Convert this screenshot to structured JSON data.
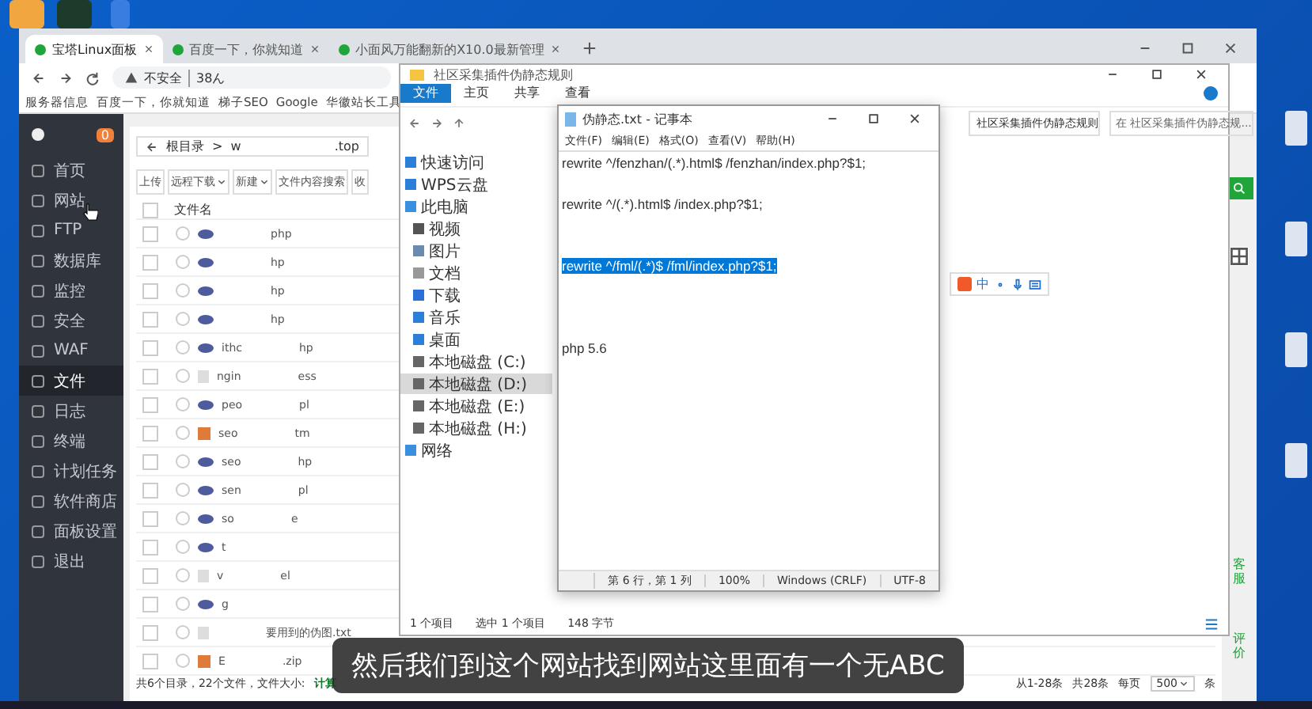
{
  "browser": {
    "tabs": [
      {
        "label": "宝塔Linux面板",
        "selected": true
      },
      {
        "label": "百度一下，你就知道",
        "selected": false
      },
      {
        "label": "小面风万能翻新的X10.0最新管理",
        "selected": false
      }
    ],
    "address": {
      "security": "不安全",
      "url": "38ん"
    },
    "bookmarks": [
      "服务器信息",
      "百度一下，你就知道",
      "梯子SEO",
      "Google",
      "华徽站长工具"
    ]
  },
  "panel": {
    "badge": "0",
    "sidebar": [
      {
        "label": "首页",
        "selected": false
      },
      {
        "label": "网站",
        "selected": false
      },
      {
        "label": "FTP",
        "selected": false
      },
      {
        "label": "数据库",
        "selected": false
      },
      {
        "label": "监控",
        "selected": false
      },
      {
        "label": "安全",
        "selected": false
      },
      {
        "label": "WAF",
        "selected": false
      },
      {
        "label": "文件",
        "selected": true
      },
      {
        "label": "日志",
        "selected": false
      },
      {
        "label": "终端",
        "selected": false
      },
      {
        "label": "计划任务",
        "selected": false
      },
      {
        "label": "软件商店",
        "selected": false
      },
      {
        "label": "面板设置",
        "selected": false
      },
      {
        "label": "退出",
        "selected": false
      }
    ],
    "breadcrumb": {
      "root": "根目录",
      "sep": ">",
      "folder": "w",
      "end": ".top"
    },
    "toolbar": [
      {
        "label": "上传",
        "kind": "plain"
      },
      {
        "label": "远程下载",
        "kind": "dropdown"
      },
      {
        "label": "新建",
        "kind": "dropdown"
      },
      {
        "label": "文件内容搜索",
        "kind": "plain"
      },
      {
        "label": "收",
        "kind": "plain"
      }
    ],
    "column": "文件名",
    "all_checked": false,
    "rows": [
      {
        "kind": "php",
        "right": "php",
        "checked": false
      },
      {
        "kind": "php",
        "right": "hp",
        "checked": false
      },
      {
        "kind": "php",
        "right": "hp",
        "checked": false
      },
      {
        "kind": "php",
        "right": "hp",
        "checked": false
      },
      {
        "kind": "php",
        "left": "ithc",
        "right": "hp",
        "checked": false
      },
      {
        "kind": "text",
        "left": "ngin",
        "right": "ess",
        "checked": false
      },
      {
        "kind": "php",
        "left": "peo",
        "right": "pl",
        "checked": false
      },
      {
        "kind": "archive",
        "left": "seo",
        "right": "tm",
        "checked": false
      },
      {
        "kind": "php",
        "left": "seo",
        "right": "hp",
        "checked": false
      },
      {
        "kind": "php",
        "left": "sen",
        "right": "pl",
        "checked": false
      },
      {
        "kind": "php",
        "left": "so",
        "right": "e",
        "checked": false
      },
      {
        "kind": "php",
        "left": "t",
        "checked": false
      },
      {
        "kind": "text",
        "left": "v",
        "right": "el",
        "checked": false
      },
      {
        "kind": "php",
        "left": "g",
        "checked": false
      },
      {
        "kind": "text",
        "right": "要用到的伪图.txt",
        "checked": false
      },
      {
        "kind": "archive",
        "left": "E",
        "right": ".zip",
        "checked": false
      }
    ],
    "summary": "共6个目录，22个文件，文件大小:",
    "calc_link": "计算",
    "pagination": [
      "从1-28条",
      "共28条",
      "每页"
    ],
    "page_size": "500",
    "page_unit": "条",
    "side_links": [
      "客服",
      "评价"
    ]
  },
  "explorer": {
    "title": "社区采集插件伪静态规则",
    "ribbon": [
      {
        "label": "文件",
        "selected": true
      },
      {
        "label": "主页",
        "selected": false
      },
      {
        "label": "共享",
        "selected": false
      },
      {
        "label": "查看",
        "selected": false
      }
    ],
    "path": "社区采集插件伪静态规则",
    "search": {
      "placeholder": "在 社区采集插件伪静态规..."
    },
    "nav": [
      {
        "label": "快速访问",
        "kind": "star",
        "selected": false
      },
      {
        "label": "WPS云盘",
        "kind": "cloud",
        "selected": false
      },
      {
        "label": "此电脑",
        "kind": "pc",
        "selected": false,
        "children": [
          {
            "label": "视频",
            "kind": "video",
            "selected": false
          },
          {
            "label": "图片",
            "kind": "image",
            "selected": false
          },
          {
            "label": "文档",
            "kind": "doc",
            "selected": false
          },
          {
            "label": "下载",
            "kind": "download",
            "selected": false
          },
          {
            "label": "音乐",
            "kind": "music",
            "selected": false
          },
          {
            "label": "桌面",
            "kind": "desktop",
            "selected": false
          },
          {
            "label": "本地磁盘 (C:)",
            "kind": "disk",
            "selected": false
          },
          {
            "label": "本地磁盘 (D:)",
            "kind": "disk",
            "selected": true
          },
          {
            "label": "本地磁盘 (E:)",
            "kind": "disk",
            "selected": false
          },
          {
            "label": "本地磁盘 (H:)",
            "kind": "disk",
            "selected": false
          }
        ]
      },
      {
        "label": "网络",
        "kind": "network",
        "selected": false
      }
    ],
    "status": [
      "1 个项目",
      "选中 1 个项目",
      "148 字节"
    ]
  },
  "ime": {
    "mode": "中"
  },
  "notepad": {
    "title": "伪静态.txt - 记事本",
    "menu": [
      "文件(F)",
      "编辑(E)",
      "格式(O)",
      "查看(V)",
      "帮助(H)"
    ],
    "lines": [
      {
        "kind": "text",
        "text": "rewrite ^/fenzhan/(.*).html$ /fenzhan/index.php?$1;",
        "selected": false
      },
      {
        "kind": "blank",
        "selected": false
      },
      {
        "kind": "text",
        "text": "rewrite ^/(.*).html$ /index.php?$1;",
        "selected": false
      },
      {
        "kind": "blank",
        "selected": false
      },
      {
        "kind": "blank",
        "selected": false
      },
      {
        "kind": "text",
        "text": "rewrite ^/fml/(.*)$ /fml/index.php?$1;",
        "selected": true
      },
      {
        "kind": "blank",
        "selected": false
      },
      {
        "kind": "blank",
        "selected": false
      },
      {
        "kind": "blank",
        "selected": false
      },
      {
        "kind": "text",
        "text": "php 5.6",
        "selected": false
      }
    ],
    "status": [
      "第 6 行，第 1 列",
      "100%",
      "Windows (CRLF)",
      "UTF-8"
    ]
  },
  "subtitle": "然后我们到这个网站找到网站这里面有一个无ABC"
}
